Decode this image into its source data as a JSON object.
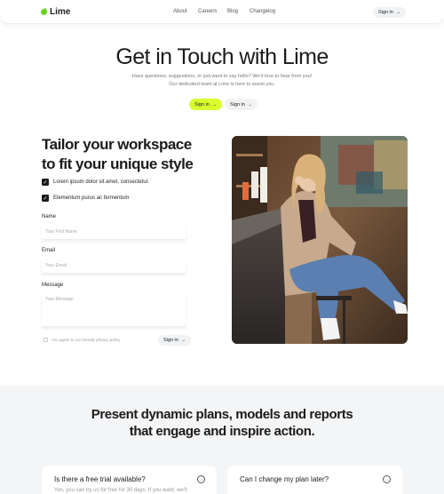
{
  "brand": {
    "name": "Lime",
    "accent": "#d9ff2e",
    "logo_color": "#6ad12b"
  },
  "nav": {
    "links": [
      "About",
      "Careers",
      "Blog",
      "Changelog"
    ],
    "signin": "Sign in",
    "arrow": "→"
  },
  "hero": {
    "title": "Get in Touch with Lime",
    "subtitle": "Have questions, suggestions, or just want to say hello? We'd love to hear from you! Our dedicated team at Lime is here to assist you.",
    "primary_button": "Sign in",
    "secondary_button": "Sign in"
  },
  "form": {
    "heading_line1": "Tailor your workspace",
    "heading_line2": "to fit your unique style",
    "checks": [
      "Lorem ipsum dolor sit amet, consectetur.",
      "Elementum purus ac fermentum"
    ],
    "name_label": "Name",
    "name_placeholder": "Your First Name",
    "email_label": "Email",
    "email_placeholder": "Your Email",
    "message_label": "Message",
    "message_placeholder": "Your Message",
    "agree_text": "You agree to our friendly privacy policy",
    "submit": "Sign in"
  },
  "section2": {
    "title_line1": "Present dynamic plans, models and reports",
    "title_line2": "that engage and inspire action."
  },
  "faq": [
    {
      "question": "Is there a free trial available?",
      "answer": "Yes, you can try us for free for 30 days. If you want, we'll"
    },
    {
      "question": "Can I change my plan later?",
      "answer": ""
    }
  ]
}
